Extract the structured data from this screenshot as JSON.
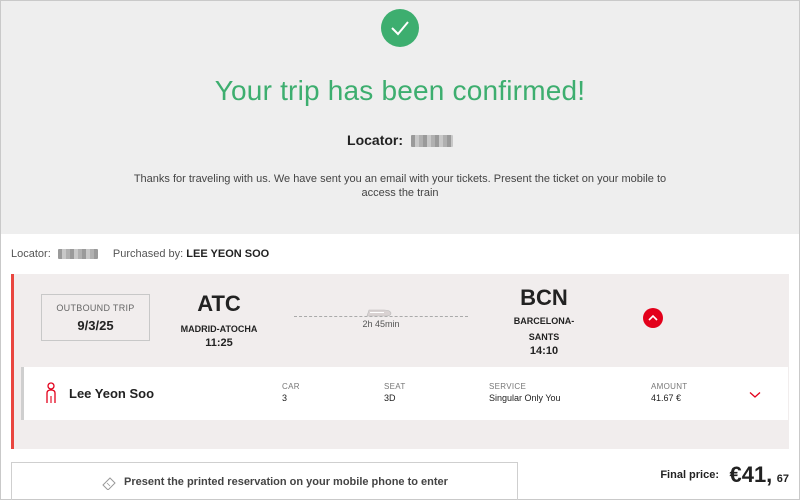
{
  "confirmation": {
    "title": "Your trip has been confirmed!",
    "locator_label": "Locator:",
    "message": "Thanks for traveling with us. We have sent you an email with your tickets. Present the ticket on your mobile to access the train"
  },
  "meta": {
    "locator_label": "Locator:",
    "purchased_by_label": "Purchased by:",
    "purchased_by": "LEE YEON SOO"
  },
  "trip": {
    "outbound_label": "OUTBOUND TRIP",
    "date": "9/3/25",
    "origin": {
      "code": "ATC",
      "name": "MADRID-ATOCHA",
      "time": "11:25"
    },
    "destination": {
      "code": "BCN",
      "name_line1": "BARCELONA-",
      "name_line2": "SANTS",
      "time": "14:10"
    },
    "duration": "2h 45min",
    "passenger": {
      "name": "Lee Yeon Soo",
      "car_label": "CAR",
      "car": "3",
      "seat_label": "SEAT",
      "seat": "3D",
      "service_label": "SERVICE",
      "service": "Singular Only You",
      "amount_label": "AMOUNT",
      "amount": "41.67 €"
    }
  },
  "footer": {
    "present_text": "Present the printed reservation on your mobile phone to enter",
    "final_price_label": "Final price:",
    "price_int": "€41,",
    "price_dec": "67"
  },
  "icons": {
    "check": "check-icon",
    "train": "train-icon",
    "collapse": "chevron-up-icon",
    "passenger": "person-icon",
    "expand": "chevron-down-icon",
    "ticket": "ticket-icon"
  },
  "colors": {
    "success": "#3dae6f",
    "accent": "#e3001b",
    "card_border": "#e9463f",
    "card_bg": "#f1eded",
    "header_bg": "#eeeeee"
  }
}
